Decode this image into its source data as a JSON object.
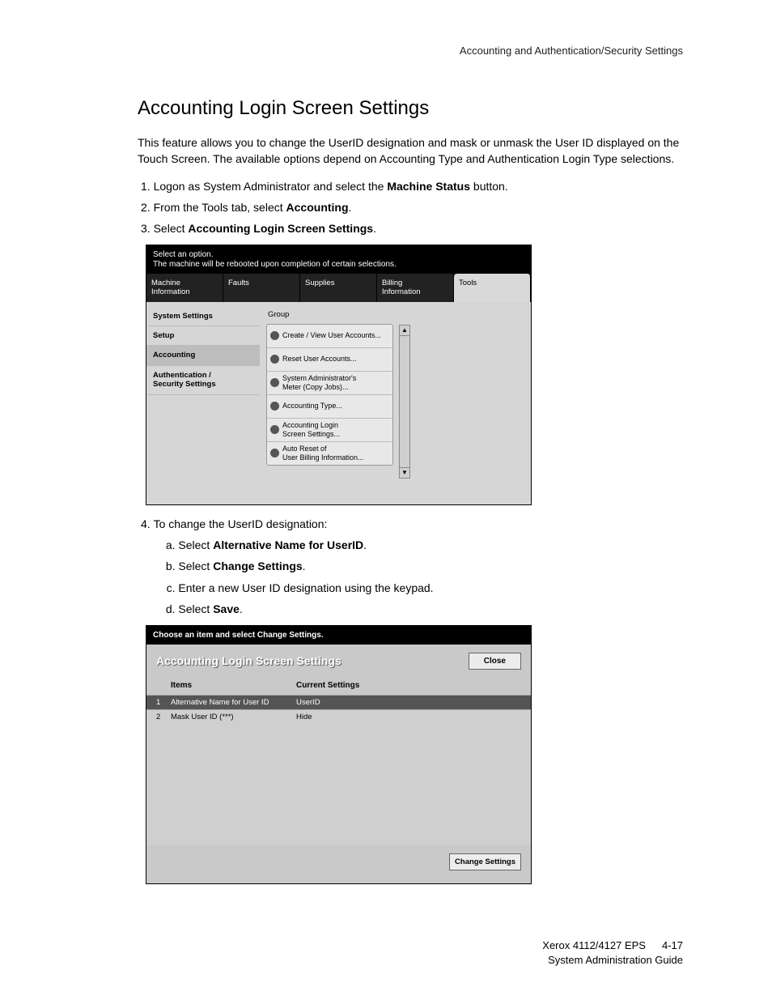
{
  "header": "Accounting and Authentication/Security Settings",
  "title": "Accounting Login Screen Settings",
  "intro": "This feature allows you to change the UserID designation and mask or unmask the User ID displayed on the Touch Screen. The available options depend on Accounting Type and Authentication Login Type selections.",
  "steps": {
    "s1a": "Logon as System Administrator and select the ",
    "s1b": "Machine Status",
    "s1c": " button.",
    "s2a": "From the Tools tab, select ",
    "s2b": "Accounting",
    "s2c": ".",
    "s3a": "Select ",
    "s3b": "Accounting Login Screen Settings",
    "s3c": ".",
    "s4": "To change the UserID designation:",
    "s4a_a": "Select ",
    "s4a_b": "Alternative Name for UserID",
    "s4a_c": ".",
    "s4b_a": "Select ",
    "s4b_b": "Change Settings",
    "s4b_c": ".",
    "s4c": "Enter a new User ID designation using the keypad.",
    "s4d_a": "Select ",
    "s4d_b": "Save",
    "s4d_c": "."
  },
  "shot1": {
    "title1": "Select an option.",
    "title2": "The machine will be rebooted upon completion of certain selections.",
    "tabs": [
      "Machine\nInformation",
      "Faults",
      "Supplies",
      "Billing\nInformation",
      "Tools"
    ],
    "side": [
      "System Settings",
      "Setup",
      "Accounting",
      "Authentication /\nSecurity Settings"
    ],
    "group": "Group",
    "items": [
      "Create / View User Accounts...",
      "Reset User Accounts...",
      "System Administrator's\nMeter (Copy Jobs)...",
      "Accounting Type...",
      "Accounting Login\nScreen Settings...",
      "Auto Reset of\nUser Billing Information..."
    ]
  },
  "shot2": {
    "bar": "Choose an item and select Change Settings.",
    "title": "Accounting Login Screen Settings",
    "close": "Close",
    "col_items": "Items",
    "col_current": "Current Settings",
    "rows": [
      {
        "idx": "1",
        "item": "Alternative Name for User ID",
        "val": "UserID"
      },
      {
        "idx": "2",
        "item": "Mask User ID (***)",
        "val": "Hide"
      }
    ],
    "change": "Change Settings"
  },
  "footer": {
    "line1a": "Xerox 4112/4127 EPS",
    "pgnum": "4-17",
    "line2": "System Administration Guide"
  }
}
